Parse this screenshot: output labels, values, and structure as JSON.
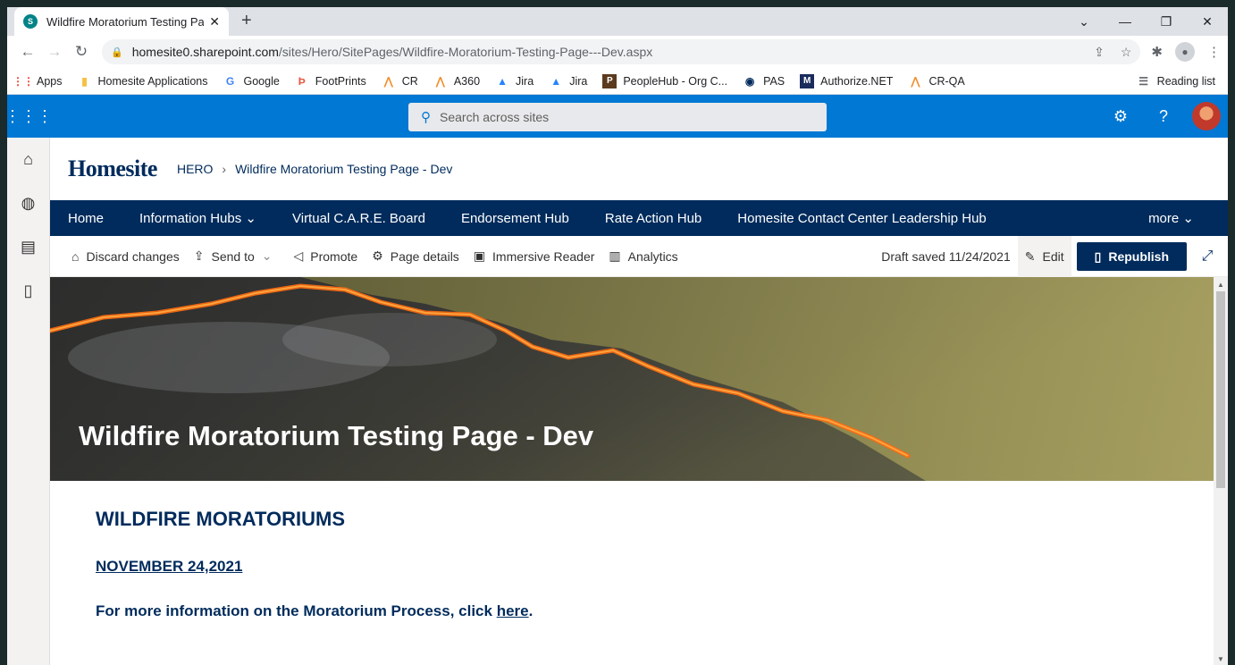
{
  "browser": {
    "tab_title": "Wildfire Moratorium Testing Page - Dev",
    "tab_close": "✕",
    "new_tab": "+",
    "url_host": "homesite0.sharepoint.com",
    "url_path": "/sites/Hero/SitePages/Wildfire-Moratorium-Testing-Page---Dev.aspx",
    "bookmarks": [
      {
        "label": "Apps",
        "icon": "apps-grid-icon"
      },
      {
        "label": "Homesite Applications",
        "icon": "folder-icon"
      },
      {
        "label": "Google",
        "icon": "google-icon"
      },
      {
        "label": "FootPrints",
        "icon": "footprints-icon"
      },
      {
        "label": "CR",
        "icon": "confluence-icon"
      },
      {
        "label": "A360",
        "icon": "confluence-icon"
      },
      {
        "label": "Jira",
        "icon": "jira-icon"
      },
      {
        "label": "Jira",
        "icon": "jira-icon"
      },
      {
        "label": "PeopleHub - Org C...",
        "icon": "peoplehub-icon"
      },
      {
        "label": "PAS",
        "icon": "pas-icon"
      },
      {
        "label": "Authorize.NET",
        "icon": "authorize-icon"
      },
      {
        "label": "CR-QA",
        "icon": "confluence-icon"
      }
    ],
    "reading_list": "Reading list"
  },
  "suite": {
    "search_placeholder": "Search across sites"
  },
  "site": {
    "logo": "Homesite",
    "breadcrumb_root": "HERO",
    "breadcrumb_page": "Wildfire Moratorium Testing Page - Dev",
    "nav": [
      "Home",
      "Information Hubs",
      "Virtual C.A.R.E. Board",
      "Endorsement Hub",
      "Rate Action Hub",
      "Homesite Contact Center Leadership Hub"
    ],
    "nav_more": "more"
  },
  "commands": {
    "discard": "Discard changes",
    "send_to": "Send to",
    "promote": "Promote",
    "page_details": "Page details",
    "immersive_reader": "Immersive Reader",
    "analytics": "Analytics",
    "draft_status": "Draft saved 11/24/2021",
    "edit": "Edit",
    "republish": "Republish"
  },
  "page": {
    "hero_title": "Wildfire Moratorium Testing Page - Dev",
    "heading": "WILDFIRE MORATORIUMS",
    "date": "NOVEMBER 24,2021",
    "info_text": "For more information on the Moratorium Process, click ",
    "info_link": "here",
    "info_end": "."
  }
}
